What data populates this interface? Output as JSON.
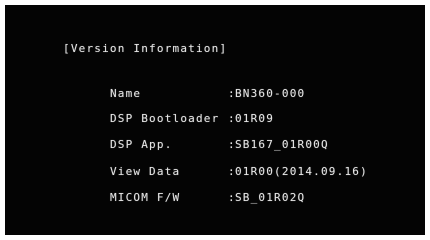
{
  "screen": {
    "title": "[Version Information]",
    "rows": [
      {
        "label": "Name",
        "value": "BN360-000"
      },
      {
        "label": "DSP Bootloader",
        "value": "01R09"
      },
      {
        "label": "DSP App.",
        "value": "SB167_01R00Q"
      },
      {
        "label": "View Data",
        "value": "01R00(2014.09.16)"
      },
      {
        "label": "MICOM F/W",
        "value": "SB_01R02Q"
      }
    ],
    "separator": ":"
  }
}
